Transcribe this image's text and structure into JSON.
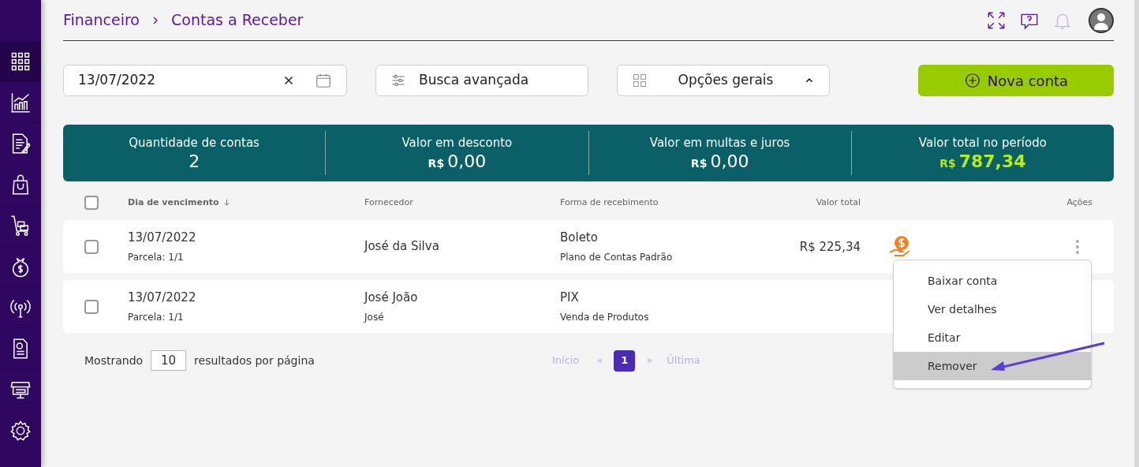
{
  "sidebar": {
    "items": [
      {
        "kind": "apps",
        "selected": true
      },
      {
        "kind": "chart",
        "selected": false
      },
      {
        "kind": "document",
        "selected": false
      },
      {
        "kind": "bag",
        "selected": false
      },
      {
        "kind": "cart",
        "selected": false
      },
      {
        "kind": "money",
        "selected": false
      },
      {
        "kind": "signal",
        "selected": false
      },
      {
        "kind": "report",
        "selected": false
      },
      {
        "kind": "store",
        "selected": false
      },
      {
        "kind": "settings",
        "selected": false
      }
    ]
  },
  "breadcrumb": [
    "Financeiro",
    "Contas a Receber"
  ],
  "date_field": {
    "value": "13/07/2022"
  },
  "advanced_search": "Busca avançada",
  "general_options": {
    "label": "Opções gerais",
    "expanded": true
  },
  "new_button": "Nova conta",
  "summary": [
    {
      "label": "Quantidade de contas",
      "value": "2"
    },
    {
      "label": "Valor em desconto",
      "currency": "R$",
      "value": "0,00"
    },
    {
      "label": "Valor em multas e juros",
      "currency": "R$",
      "value": "0,00"
    },
    {
      "label": "Valor total no período",
      "currency": "R$",
      "value": "787,34",
      "highlight": true
    }
  ],
  "table": {
    "select_all": false,
    "columns": [
      "Dia de vencimento",
      "Fornecedor",
      "Forma de recebimento",
      "Valor total",
      "Ações"
    ],
    "rows": [
      {
        "checked": false,
        "date": "13/07/2022",
        "installment": "Parcela: 1/1",
        "supplier": "José da Silva",
        "method": "Boleto",
        "category": "Plano de Contas Padrão",
        "total": "R$ 225,34",
        "actions": true
      },
      {
        "checked": false,
        "date": "13/07/2022",
        "installment": "Parcela: 1/1",
        "supplier": "José João",
        "supplier_detail": "José",
        "method": "PIX",
        "category": "Venda de Produtos"
      }
    ]
  },
  "page_size": {
    "before": "Mostrando",
    "value": "10",
    "after": "resultados por página"
  },
  "pagination": {
    "first": "Início",
    "prev": "«",
    "pages": [
      {
        "label": "1",
        "selected": true
      }
    ],
    "next": "»",
    "last": "Última"
  },
  "menu": [
    {
      "label": "Baixar conta",
      "selected": false
    },
    {
      "label": "Ver detalhes",
      "selected": false
    },
    {
      "label": "Editar",
      "selected": false
    },
    {
      "label": "Remover",
      "selected": true
    }
  ]
}
